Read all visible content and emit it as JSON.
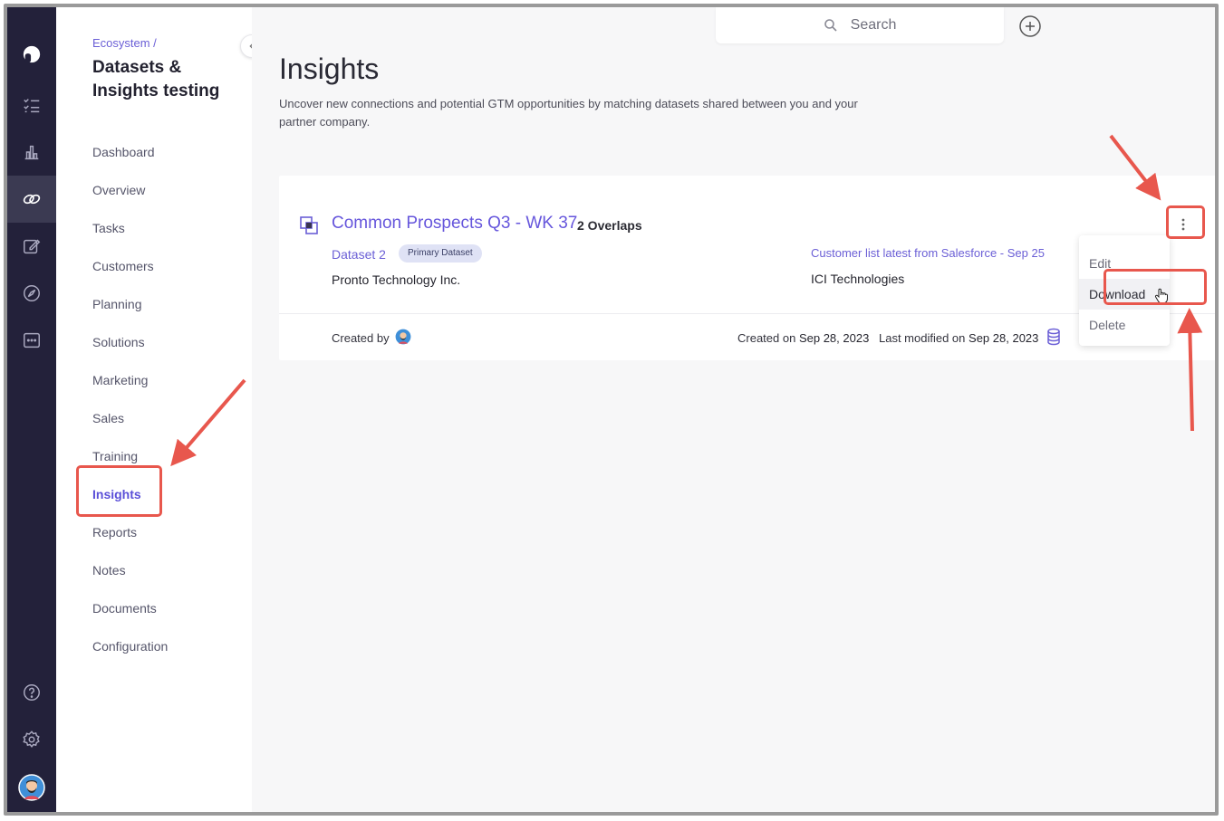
{
  "breadcrumb": "Ecosystem /",
  "sidebar": {
    "title": "Datasets & Insights testing",
    "items": [
      {
        "label": "Dashboard",
        "active": false
      },
      {
        "label": "Overview",
        "active": false
      },
      {
        "label": "Tasks",
        "active": false
      },
      {
        "label": "Customers",
        "active": false
      },
      {
        "label": "Planning",
        "active": false
      },
      {
        "label": "Solutions",
        "active": false
      },
      {
        "label": "Marketing",
        "active": false
      },
      {
        "label": "Sales",
        "active": false
      },
      {
        "label": "Training",
        "active": false
      },
      {
        "label": "Insights",
        "active": true
      },
      {
        "label": "Reports",
        "active": false
      },
      {
        "label": "Notes",
        "active": false
      },
      {
        "label": "Documents",
        "active": false
      },
      {
        "label": "Configuration",
        "active": false
      }
    ]
  },
  "rail": {
    "icons": [
      "logo-icon",
      "checklist-icon",
      "bar-chart-icon",
      "partnership-icon",
      "edit-note-icon",
      "compass-icon",
      "chat-icon",
      "help-icon",
      "settings-icon",
      "user-avatar"
    ],
    "active": "partnership-icon"
  },
  "header": {
    "search_placeholder": "Search",
    "add_icon": "plus-circle-icon"
  },
  "page": {
    "title": "Insights",
    "description": "Uncover new connections and potential GTM opportunities by matching datasets shared between you and your partner company."
  },
  "insight_card": {
    "title": "Common Prospects Q3 - WK 37",
    "overlaps": "2 Overlaps",
    "dataset_left": {
      "name": "Dataset 2",
      "badge": "Primary Dataset",
      "company": "Pronto Technology Inc."
    },
    "dataset_right": {
      "name": "Customer list latest from Salesforce - Sep 25",
      "company": "ICI Technologies"
    },
    "created_by_label": "Created by",
    "created_on_label": "Created on",
    "created_on": "Sep 28, 2023",
    "modified_label": "Last modified on",
    "modified_on": "Sep 28, 2023"
  },
  "context_menu": {
    "items": [
      "Edit",
      "Download",
      "Delete"
    ],
    "hovered": "Download"
  },
  "colors": {
    "accent": "#6656dc",
    "rail_bg": "#23213a",
    "annotation": "#e8574d"
  }
}
